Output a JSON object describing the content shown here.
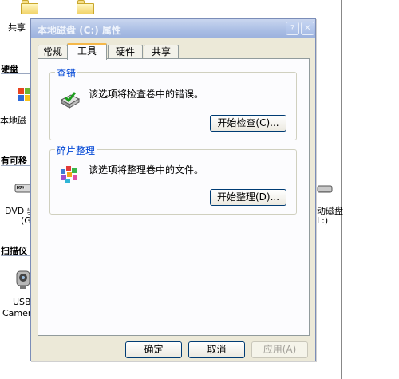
{
  "background": {
    "share_label": "共享",
    "sections": {
      "hard_disks": "硬盘",
      "removable": "有可移",
      "scanners": "扫描仪"
    },
    "items": {
      "local_disk": "本地磁",
      "dvd_line1": "DVD 驱",
      "dvd_line2": "(G",
      "removable_disk_line1": "动磁盘",
      "removable_disk_line2": "L:)",
      "usb_line1": "USB",
      "usb_line2": "Camera"
    }
  },
  "dialog": {
    "title": "本地磁盘 (C:) 属性",
    "tabs": [
      {
        "label": "常规",
        "active": false
      },
      {
        "label": "工具",
        "active": true
      },
      {
        "label": "硬件",
        "active": false
      },
      {
        "label": "共享",
        "active": false
      }
    ],
    "error_check": {
      "title": "查错",
      "text": "该选项将检查卷中的错误。",
      "button": "开始检查(C)..."
    },
    "defrag": {
      "title": "碎片整理",
      "text": "该选项将整理卷中的文件。",
      "button": "开始整理(D)..."
    },
    "buttons": {
      "ok": "确定",
      "cancel": "取消",
      "apply": "应用(A)"
    }
  },
  "colors": {
    "dialog_bg": "#ece9d8",
    "title_bar": "#a9bde4",
    "group_title": "#0046d5",
    "active_tab_accent": "#f5b84a"
  }
}
